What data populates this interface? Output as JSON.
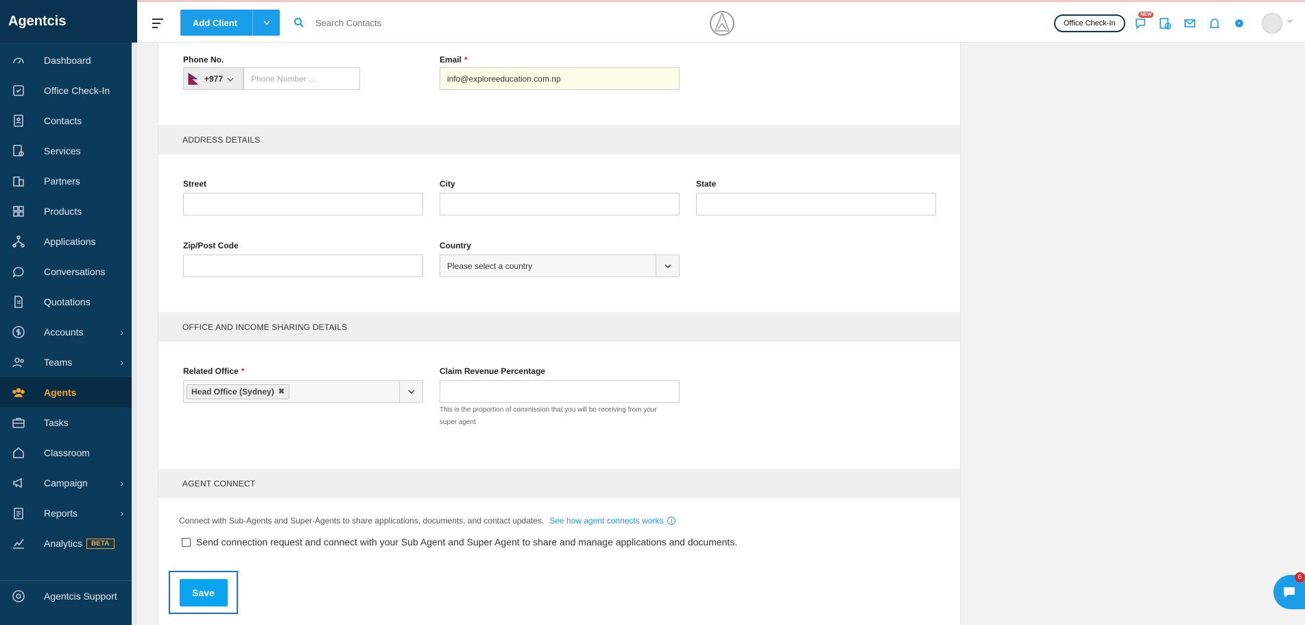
{
  "brand": "Agentcis",
  "sidebar": {
    "items": [
      {
        "label": "Dashboard",
        "icon": "dashboard-icon"
      },
      {
        "label": "Office Check-In",
        "icon": "checkin-icon"
      },
      {
        "label": "Contacts",
        "icon": "contacts-icon"
      },
      {
        "label": "Services",
        "icon": "services-icon"
      },
      {
        "label": "Partners",
        "icon": "partners-icon"
      },
      {
        "label": "Products",
        "icon": "products-icon"
      },
      {
        "label": "Applications",
        "icon": "applications-icon"
      },
      {
        "label": "Conversations",
        "icon": "conversations-icon"
      },
      {
        "label": "Quotations",
        "icon": "quotations-icon"
      },
      {
        "label": "Accounts",
        "icon": "dollar-icon"
      },
      {
        "label": "Teams",
        "icon": "teams-icon"
      },
      {
        "label": "Agents",
        "icon": "agents-icon"
      },
      {
        "label": "Tasks",
        "icon": "briefcase-icon"
      },
      {
        "label": "Classroom",
        "icon": "classroom-icon"
      },
      {
        "label": "Campaign",
        "icon": "megaphone-icon"
      },
      {
        "label": "Reports",
        "icon": "reports-icon"
      },
      {
        "label": "Analytics",
        "icon": "analytics-icon",
        "badge": "BETA"
      }
    ],
    "support_label": "Agentcis Support",
    "active": "Agents",
    "active_color": "#f5a623"
  },
  "topbar": {
    "add_client_label": "Add Client",
    "search_placeholder": "Search Contacts",
    "checkin_label": "Office Check-In",
    "new_badge": "NEW"
  },
  "form": {
    "phone_label": "Phone No.",
    "phone_code": "+977",
    "phone_placeholder": "Phone Number ...",
    "email_label": "Email",
    "email_value": "info@exploreeducation.com.np",
    "address_section": "ADDRESS DETAILS",
    "street_label": "Street",
    "city_label": "City",
    "state_label": "State",
    "zip_label": "Zip/Post Code",
    "country_label": "Country",
    "country_placeholder": "Please select a country",
    "office_section": "OFFICE AND INCOME SHARING DETAILS",
    "related_office_label": "Related Office",
    "related_office_chip": "Head Office (Sydney)",
    "claim_label": "Claim Revenue Percentage",
    "claim_hint_1": "This is the proportion of commission that you will be receiving from your",
    "claim_hint_2": "super agent",
    "agent_connect_section": "AGENT CONNECT",
    "connect_desc": "Connect with Sub-Agents and Super-Agents to share applications, documents, and contact updates.",
    "connect_link": "See how agent connects works",
    "connect_checkbox_label": "Send connection request and connect with your Sub Agent and Super Agent to share and manage applications and documents.",
    "save_label": "Save"
  },
  "chat": {
    "badge_count": "6"
  },
  "colors": {
    "sidebar_bg": "#0c3a5b",
    "accent": "#1a9ee9",
    "required": "#e02424"
  }
}
